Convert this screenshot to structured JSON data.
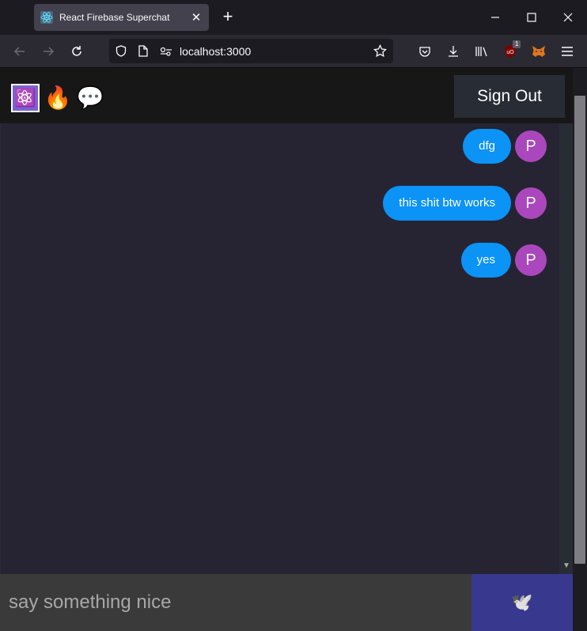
{
  "browser": {
    "tab": {
      "title": "React Firebase Superchat",
      "close": "✕"
    },
    "new_tab": "+",
    "url": "localhost:3000",
    "ublock_count": "1"
  },
  "app": {
    "logo": [
      "⚛️",
      "🔥",
      "💬"
    ],
    "sign_out": "Sign Out",
    "messages": [
      {
        "text": "dfg",
        "avatar": "P"
      },
      {
        "text": "this shit btw works",
        "avatar": "P"
      },
      {
        "text": "yes",
        "avatar": "P"
      }
    ],
    "composer": {
      "placeholder": "say something nice",
      "send": "🕊️"
    }
  },
  "colors": {
    "bubble": "#0b93f6",
    "avatar": "#ab47bc",
    "send_button": "#38388f",
    "header": "#181717"
  }
}
